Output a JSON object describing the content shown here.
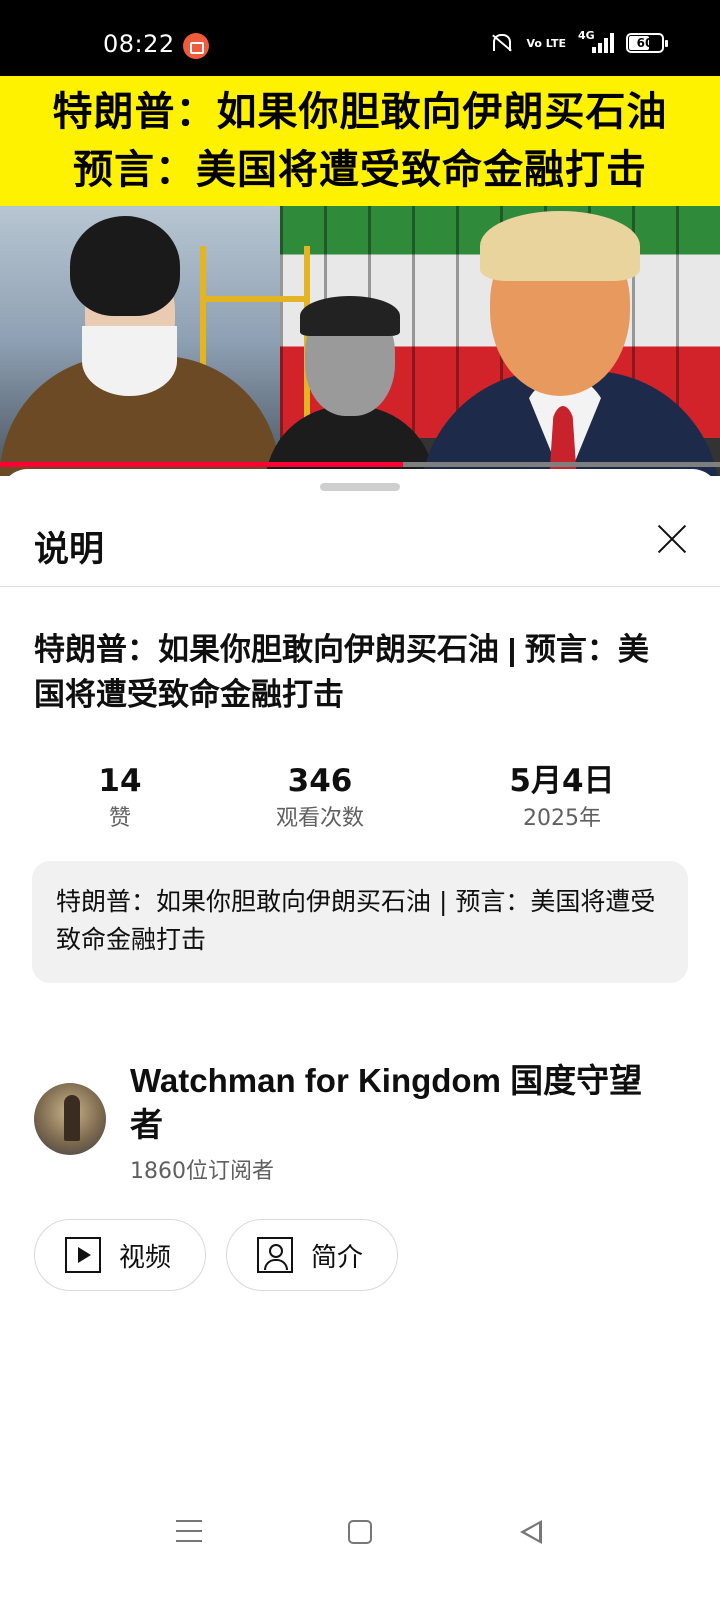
{
  "status_bar": {
    "time": "08:22",
    "network": "4G",
    "volte": "Vo LTE",
    "battery": "60"
  },
  "thumbnail": {
    "line1": "特朗普：如果你胆敢向伊朗买石油",
    "line2": "预言：美国将遭受致命金融打击",
    "progress_fraction": 0.56
  },
  "sheet": {
    "title": "说明"
  },
  "video": {
    "title": "特朗普：如果你胆敢向伊朗买石油 | 预言：美国将遭受致命金融打击",
    "description": "特朗普：如果你胆敢向伊朗买石油 | 预言：美国将遭受致命金融打击"
  },
  "stats": [
    {
      "value": "14",
      "label": "赞"
    },
    {
      "value": "346",
      "label": "观看次数"
    },
    {
      "value": "5月4日",
      "label": "2025年"
    }
  ],
  "channel": {
    "name": "Watchman for Kingdom 国度守望者",
    "subscribers": "1860位订阅者"
  },
  "buttons": {
    "videos": "视频",
    "about": "简介"
  },
  "icons": {
    "close": "close-icon",
    "videos": "play-icon",
    "about": "person-icon"
  },
  "colors": {
    "banner_yellow": "#fff200",
    "progress_red": "#ff0033"
  }
}
